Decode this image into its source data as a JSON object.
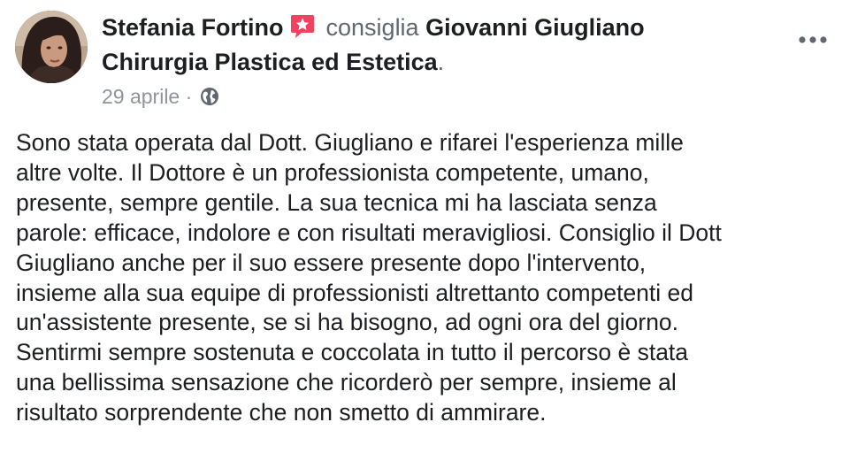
{
  "post": {
    "author_name": "Stefania Fortino",
    "action_text": "consiglia",
    "page_name_line1": "Giovanni Giugliano",
    "page_name_line2": "Chirurgia Plastica ed Estetica",
    "page_name_suffix": ".",
    "date": "29 aprile",
    "meta_separator": "·",
    "privacy_icon": "globe-icon",
    "recommend_icon": "recommendation-star-icon",
    "more_icon": "more-options-icon",
    "body_text": "Sono stata operata dal Dott. Giugliano e   rifarei l'esperienza mille\naltre volte. Il Dottore è un professionista competente, umano,\npresente, sempre gentile. La sua tecnica mi ha lasciata senza\nparole: efficace, indolore e con risultati meravigliosi. Consiglio il Dott\nGiugliano anche per il suo essere presente dopo l'intervento,\ninsieme alla sua equipe di professionisti altrettanto competenti ed\nun'assistente presente, se si ha bisogno, ad ogni ora del giorno.\nSentirmi sempre sostenuta e coccolata in tutto il percorso è stata\nuna bellissima sensazione che ricorderò per sempre, insieme al\nrisultato sorprendente che non smetto di ammirare."
  },
  "colors": {
    "text_primary": "#1c1e21",
    "text_secondary": "#606770",
    "text_meta": "#90949c",
    "recommend_badge": "#f3425f",
    "icon_gray": "#606770"
  }
}
